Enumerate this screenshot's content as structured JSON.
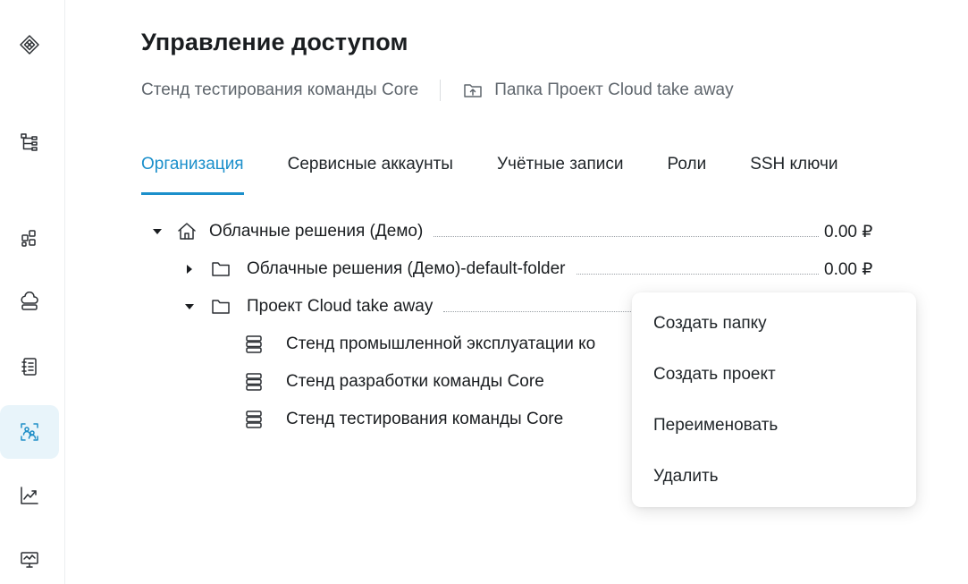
{
  "sidebar": {
    "items": [
      {
        "icon": "logo-diamond-icon"
      },
      {
        "icon": "hierarchy-tree-icon"
      },
      {
        "icon": "services-grid-icon"
      },
      {
        "icon": "cloud-storage-icon"
      },
      {
        "icon": "notebook-icon"
      },
      {
        "icon": "access-users-icon",
        "active": true
      },
      {
        "icon": "chart-line-icon"
      },
      {
        "icon": "monitor-icon"
      }
    ]
  },
  "header": {
    "title": "Управление доступом",
    "context_project": "Стенд тестирования команды Core",
    "context_folder": "Папка Проект Cloud take away"
  },
  "tabs": [
    {
      "label": "Организация",
      "active": true
    },
    {
      "label": "Сервисные аккаунты"
    },
    {
      "label": "Учётные записи"
    },
    {
      "label": "Роли"
    },
    {
      "label": "SSH ключи"
    }
  ],
  "tree": {
    "rows": [
      {
        "label": "Облачные решения (Демо)",
        "price": "0.00 ₽",
        "icon": "home-icon",
        "caret": "down"
      },
      {
        "label": "Облачные решения (Демо)-default-folder",
        "price": "0.00 ₽",
        "icon": "folder-icon",
        "caret": "right"
      },
      {
        "label": "Проект Cloud take away",
        "icon": "folder-icon",
        "caret": "down"
      },
      {
        "label": "Стенд промышленной эксплуатации ко",
        "icon": "server-stack-icon"
      },
      {
        "label": "Стенд разработки команды Core",
        "icon": "server-stack-icon"
      },
      {
        "label": "Стенд тестирования команды Core",
        "icon": "server-stack-icon"
      }
    ]
  },
  "context_menu": {
    "items": [
      "Создать папку",
      "Создать проект",
      "Переименовать",
      "Удалить"
    ]
  },
  "colors": {
    "accent": "#1b8fcb",
    "active_bg": "#e8f4fa",
    "muted_text": "#5f666d"
  }
}
